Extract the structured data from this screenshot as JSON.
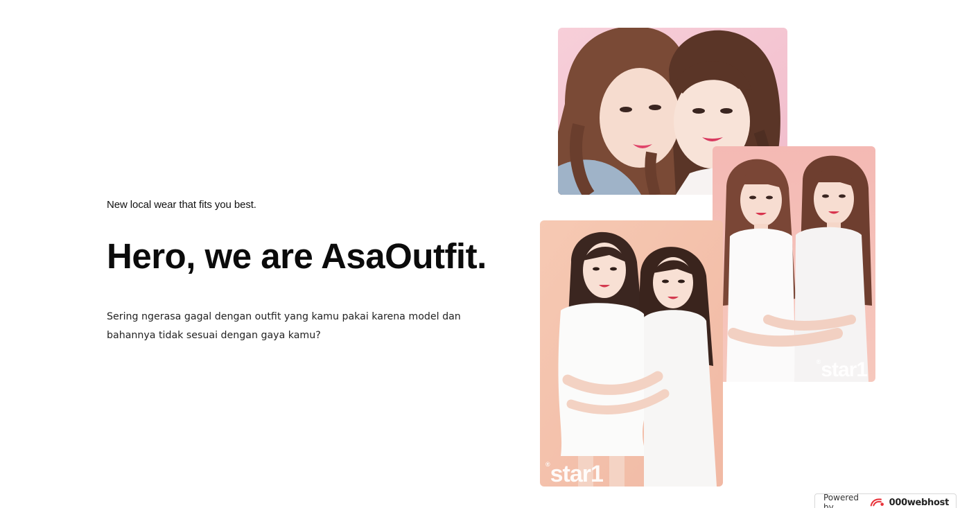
{
  "hero": {
    "tagline": "New local wear that fits you best.",
    "headline": "Hero, we are AsaOutfit.",
    "description": "Sering ngerasa gagal dengan outfit yang kamu pakai karena model dan bahannya tidak sesuai dengan gaya kamu?"
  },
  "gallery": {
    "photos": [
      {
        "name": "two-girls-braids-photo",
        "background": "#f5c6d0"
      },
      {
        "name": "two-girls-white-dresses-photo",
        "background": "#f2b8b2",
        "watermark": "star1"
      },
      {
        "name": "two-girls-white-outfits-photo",
        "background": "#f4c3ae",
        "watermark": "star1"
      }
    ],
    "watermark_mark": "®"
  },
  "footer_badge": {
    "label": "Powered by",
    "brand": "000webhost",
    "icon": "000webhost-logo-icon",
    "accent": "#e8333a"
  }
}
